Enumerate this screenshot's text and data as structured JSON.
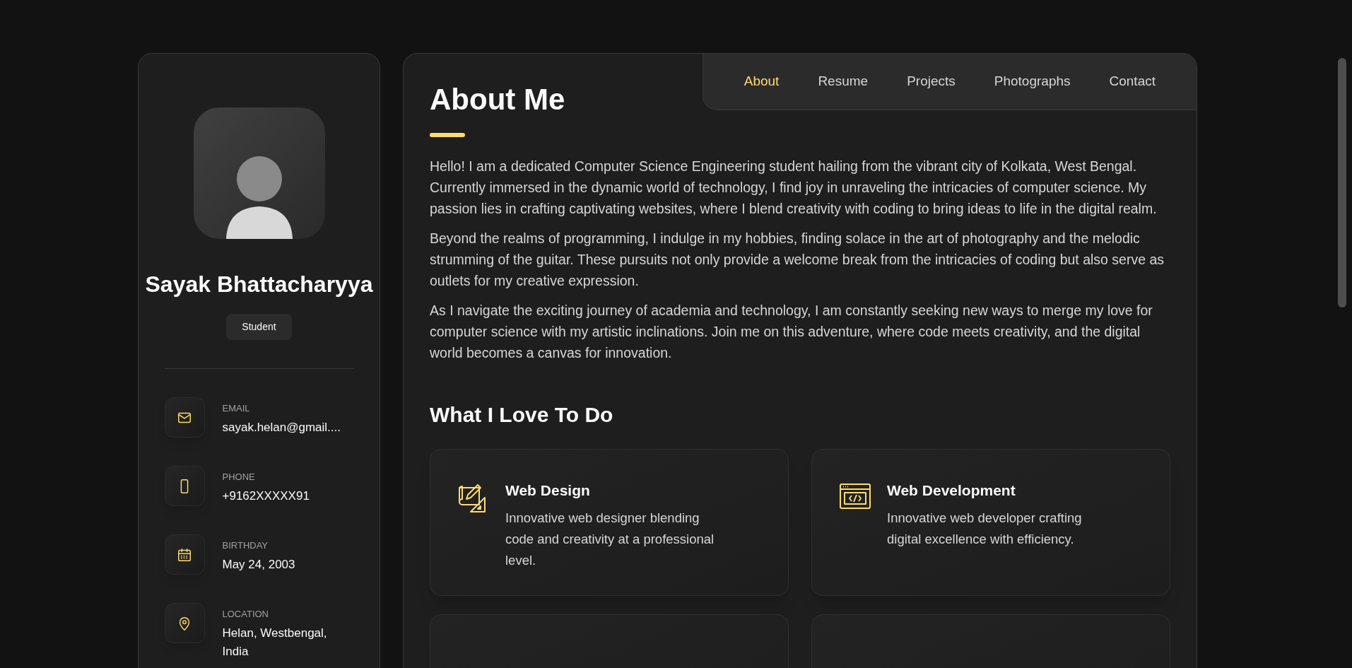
{
  "profile": {
    "name": "Sayak Bhattacharyya",
    "role": "Student"
  },
  "contacts": [
    {
      "kind": "email",
      "label": "EMAIL",
      "value": "sayak.helan@gmail...."
    },
    {
      "kind": "phone",
      "label": "PHONE",
      "value": "+9162XXXXX91"
    },
    {
      "kind": "birthday",
      "label": "BIRTHDAY",
      "value": "May 24, 2003"
    },
    {
      "kind": "location",
      "label": "LOCATION",
      "value": "Helan, Westbengal, India"
    }
  ],
  "nav": [
    {
      "label": "About",
      "selected": true
    },
    {
      "label": "Resume",
      "selected": false
    },
    {
      "label": "Projects",
      "selected": false
    },
    {
      "label": "Photographs",
      "selected": false
    },
    {
      "label": "Contact",
      "selected": false
    }
  ],
  "about": {
    "title": "About Me",
    "paragraphs": [
      "Hello! I am a dedicated Computer Science Engineering student hailing from the vibrant city of Kolkata, West Bengal. Currently immersed in the dynamic world of technology, I find joy in unraveling the intricacies of computer science. My passion lies in crafting captivating websites, where I blend creativity with coding to bring ideas to life in the digital realm.",
      "Beyond the realms of programming, I indulge in my hobbies, finding solace in the art of photography and the melodic strumming of the guitar. These pursuits not only provide a welcome break from the intricacies of coding but also serve as outlets for my creative expression.",
      "As I navigate the exciting journey of academia and technology, I am constantly seeking new ways to merge my love for computer science with my artistic inclinations. Join me on this adventure, where code meets creativity, and the digital world becomes a canvas for innovation."
    ]
  },
  "services": {
    "title": "What I Love To Do",
    "items": [
      {
        "kind": "design",
        "title": "Web Design",
        "text": "Innovative web designer blending code and creativity at a professional level."
      },
      {
        "kind": "development",
        "title": "Web Development",
        "text": "Innovative web developer crafting digital excellence with efficiency."
      }
    ]
  }
}
